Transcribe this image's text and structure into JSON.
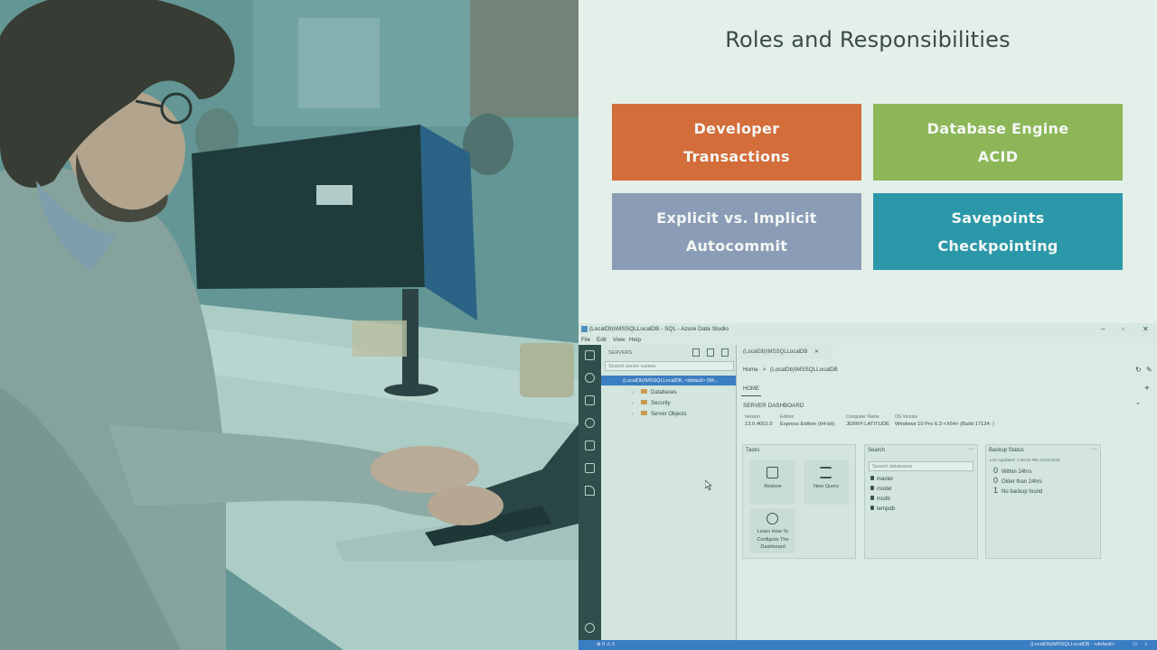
{
  "slide": {
    "title": "Roles and Responsibilities",
    "tiles": [
      {
        "line1": "Developer",
        "line2": "Transactions",
        "color": "#d36d3a"
      },
      {
        "line1": "Database Engine",
        "line2": "ACID",
        "color": "#8cb657"
      },
      {
        "line1": "Explicit vs. Implicit",
        "line2": "Autocommit",
        "color": "#8b9db6"
      },
      {
        "line1": "Savepoints",
        "line2": "Checkpointing",
        "color": "#2a98a8"
      }
    ]
  },
  "ads": {
    "window_title": "(LocalDb)\\MSSQLLocalDB - SQL - Azure Data Studio",
    "menu": [
      "File",
      "Edit",
      "View",
      "Help"
    ],
    "servers_header": "SERVERS",
    "server_search_placeholder": "Search server names",
    "server_row": "(LocalDb)\\MSSQLLocalDB, <default> (Wi...",
    "tree": [
      "Databases",
      "Security",
      "Server Objects"
    ],
    "tab_label": "(LocalDb)\\MSSQLLocalDB",
    "breadcrumb_home": "Home",
    "breadcrumb_sep": ">",
    "breadcrumb_server": "(LocalDb)\\MSSQLLocalDB",
    "home_tab": "HOME",
    "dashboard_title": "SERVER DASHBOARD",
    "props": [
      {
        "key": "Version",
        "value": "13.0.4001.0"
      },
      {
        "key": "Edition",
        "value": "Express Edition (64-bit)"
      },
      {
        "key": "Computer Name",
        "value": "JERRY-LATITUDE"
      },
      {
        "key": "OS Version",
        "value": "Windows 10 Pro 6.3 <X64> (Build 17134: )"
      }
    ],
    "tasks": {
      "header": "Tasks",
      "restore": "Restore",
      "new_query": "New Query",
      "learn": "Learn How To Configure The Dashboard"
    },
    "search_widget": {
      "header": "Search",
      "placeholder": "Search databases",
      "databases": [
        "master",
        "model",
        "msdb",
        "tempdb"
      ]
    },
    "backup": {
      "header": "Backup Status",
      "updated": "Last Updated: 7:48:02 PM 11/15/2018",
      "rows": [
        {
          "count": "0",
          "label": "Within 24hrs"
        },
        {
          "count": "0",
          "label": "Older than 24hrs"
        },
        {
          "count": "1",
          "label": "No backup found"
        }
      ]
    },
    "status_left": "⊗ 0  ⚠ 0",
    "status_right": "(LocalDb)\\MSSQLLocalDB : <default>"
  }
}
